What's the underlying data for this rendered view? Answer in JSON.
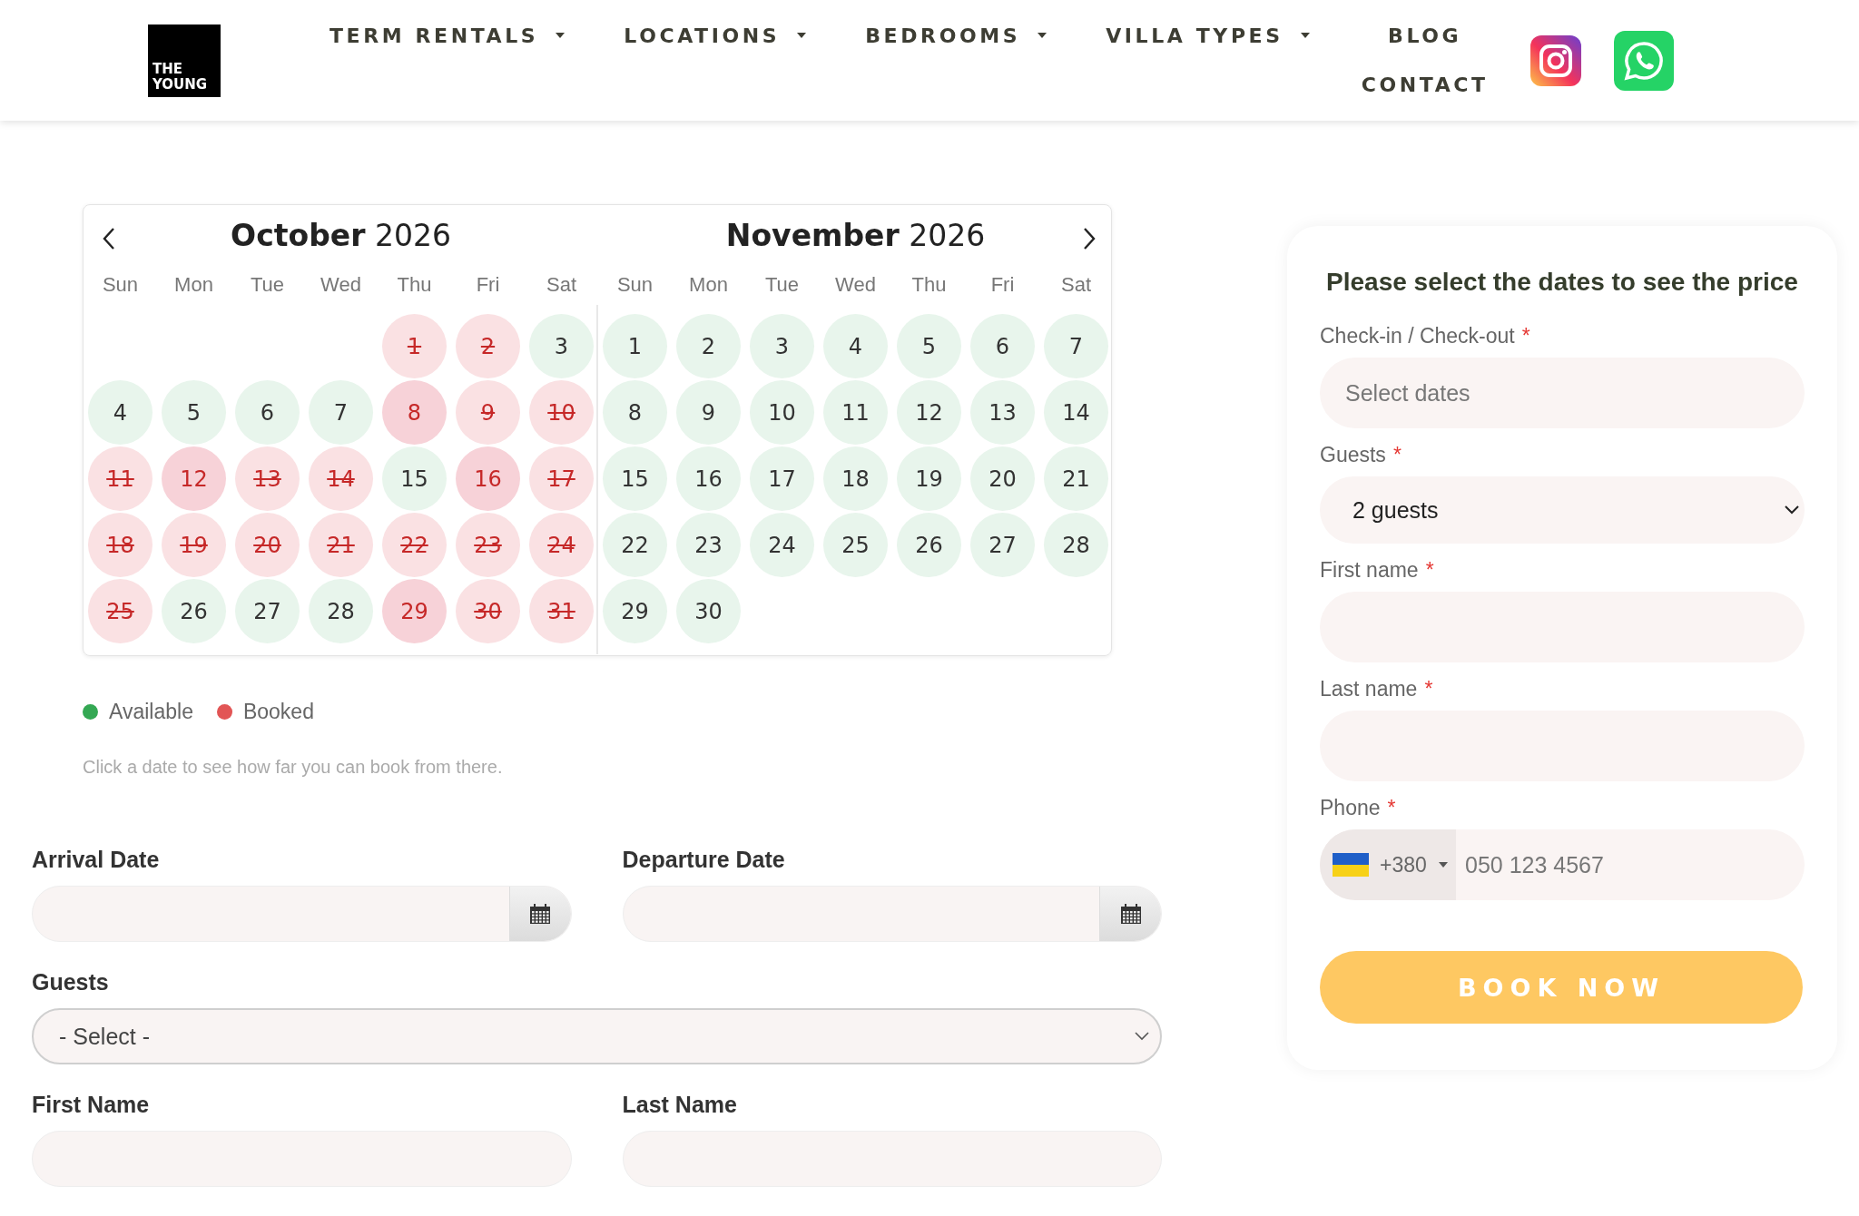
{
  "header": {
    "logo": [
      "THE",
      "YOUNG"
    ],
    "nav": [
      {
        "label": "TERM RENTALS",
        "dropdown": true
      },
      {
        "label": "LOCATIONS",
        "dropdown": true
      },
      {
        "label": "BEDROOMS",
        "dropdown": true
      },
      {
        "label": "VILLA TYPES",
        "dropdown": true
      },
      {
        "label": "BLOG",
        "dropdown": false
      },
      {
        "label": "CONTACT",
        "dropdown": false
      }
    ],
    "social": [
      {
        "kind": "instagram"
      },
      {
        "kind": "whatsapp"
      }
    ]
  },
  "calendar": {
    "months": [
      {
        "name": "October",
        "year": "2026",
        "weekdays": [
          "Sun",
          "Mon",
          "Tue",
          "Wed",
          "Thu",
          "Fri",
          "Sat"
        ],
        "days": [
          {
            "kind": "blank"
          },
          {
            "kind": "blank"
          },
          {
            "kind": "blank"
          },
          {
            "kind": "blank"
          },
          {
            "day": "1",
            "booked": true,
            "highlighted": false
          },
          {
            "day": "2",
            "booked": true,
            "highlighted": false
          },
          {
            "day": "3",
            "booked": false,
            "highlighted": false
          },
          {
            "day": "4",
            "booked": false,
            "highlighted": false
          },
          {
            "day": "5",
            "booked": false,
            "highlighted": false
          },
          {
            "day": "6",
            "booked": false,
            "highlighted": false
          },
          {
            "day": "7",
            "booked": false,
            "highlighted": false
          },
          {
            "day": "8",
            "booked": false,
            "highlighted": true
          },
          {
            "day": "9",
            "booked": true,
            "highlighted": false
          },
          {
            "day": "10",
            "booked": true,
            "highlighted": false
          },
          {
            "day": "11",
            "booked": true,
            "highlighted": false
          },
          {
            "day": "12",
            "booked": false,
            "highlighted": true
          },
          {
            "day": "13",
            "booked": true,
            "highlighted": false
          },
          {
            "day": "14",
            "booked": true,
            "highlighted": false
          },
          {
            "day": "15",
            "booked": false,
            "highlighted": false
          },
          {
            "day": "16",
            "booked": false,
            "highlighted": true
          },
          {
            "day": "17",
            "booked": true,
            "highlighted": false
          },
          {
            "day": "18",
            "booked": true,
            "highlighted": false
          },
          {
            "day": "19",
            "booked": true,
            "highlighted": false
          },
          {
            "day": "20",
            "booked": true,
            "highlighted": false
          },
          {
            "day": "21",
            "booked": true,
            "highlighted": false
          },
          {
            "day": "22",
            "booked": true,
            "highlighted": false
          },
          {
            "day": "23",
            "booked": true,
            "highlighted": false
          },
          {
            "day": "24",
            "booked": true,
            "highlighted": false
          },
          {
            "day": "25",
            "booked": true,
            "highlighted": false
          },
          {
            "day": "26",
            "booked": false,
            "highlighted": false
          },
          {
            "day": "27",
            "booked": false,
            "highlighted": false
          },
          {
            "day": "28",
            "booked": false,
            "highlighted": false
          },
          {
            "day": "29",
            "booked": false,
            "highlighted": true
          },
          {
            "day": "30",
            "booked": true,
            "highlighted": false
          },
          {
            "day": "31",
            "booked": true,
            "highlighted": false
          }
        ]
      },
      {
        "name": "November",
        "year": "2026",
        "weekdays": [
          "Sun",
          "Mon",
          "Tue",
          "Wed",
          "Thu",
          "Fri",
          "Sat"
        ],
        "days": [
          {
            "day": "1",
            "booked": false,
            "highlighted": false
          },
          {
            "day": "2",
            "booked": false,
            "highlighted": false
          },
          {
            "day": "3",
            "booked": false,
            "highlighted": false
          },
          {
            "day": "4",
            "booked": false,
            "highlighted": false
          },
          {
            "day": "5",
            "booked": false,
            "highlighted": false
          },
          {
            "day": "6",
            "booked": false,
            "highlighted": false
          },
          {
            "day": "7",
            "booked": false,
            "highlighted": false
          },
          {
            "day": "8",
            "booked": false,
            "highlighted": false
          },
          {
            "day": "9",
            "booked": false,
            "highlighted": false
          },
          {
            "day": "10",
            "booked": false,
            "highlighted": false
          },
          {
            "day": "11",
            "booked": false,
            "highlighted": false
          },
          {
            "day": "12",
            "booked": false,
            "highlighted": false
          },
          {
            "day": "13",
            "booked": false,
            "highlighted": false
          },
          {
            "day": "14",
            "booked": false,
            "highlighted": false
          },
          {
            "day": "15",
            "booked": false,
            "highlighted": false
          },
          {
            "day": "16",
            "booked": false,
            "highlighted": false
          },
          {
            "day": "17",
            "booked": false,
            "highlighted": false
          },
          {
            "day": "18",
            "booked": false,
            "highlighted": false
          },
          {
            "day": "19",
            "booked": false,
            "highlighted": false
          },
          {
            "day": "20",
            "booked": false,
            "highlighted": false
          },
          {
            "day": "21",
            "booked": false,
            "highlighted": false
          },
          {
            "day": "22",
            "booked": false,
            "highlighted": false
          },
          {
            "day": "23",
            "booked": false,
            "highlighted": false
          },
          {
            "day": "24",
            "booked": false,
            "highlighted": false
          },
          {
            "day": "25",
            "booked": false,
            "highlighted": false
          },
          {
            "day": "26",
            "booked": false,
            "highlighted": false
          },
          {
            "day": "27",
            "booked": false,
            "highlighted": false
          },
          {
            "day": "28",
            "booked": false,
            "highlighted": false
          },
          {
            "day": "29",
            "booked": false,
            "highlighted": false
          },
          {
            "day": "30",
            "booked": false,
            "highlighted": false
          }
        ]
      }
    ],
    "legend": [
      {
        "label": "Available",
        "color": "#34a853"
      },
      {
        "label": "Booked",
        "color": "#e25555"
      }
    ],
    "hint": "Click a date to see how far you can book from there."
  },
  "booking_form": {
    "rows": [
      {
        "kind": "dates",
        "fields": [
          {
            "label": "Arrival Date"
          },
          {
            "label": "Departure Date"
          }
        ]
      },
      {
        "kind": "select",
        "fields": [
          {
            "label": "Guests",
            "value": "- Select -"
          }
        ]
      },
      {
        "kind": "text",
        "fields": [
          {
            "label": "First Name"
          },
          {
            "label": "Last Name"
          }
        ]
      }
    ]
  },
  "price_card": {
    "title": "Please select the dates to see the price",
    "fields": [
      {
        "kind": "text",
        "label": "Check-in / Check-out",
        "required_mark": "*",
        "placeholder": "Select dates"
      },
      {
        "kind": "select",
        "label": "Guests",
        "required_mark": "*",
        "value": "2 guests"
      },
      {
        "kind": "text",
        "label": "First name",
        "required_mark": "*"
      },
      {
        "kind": "text",
        "label": "Last name",
        "required_mark": "*"
      },
      {
        "kind": "phone",
        "label": "Phone",
        "required_mark": "*",
        "code": "+380",
        "placeholder": "050 123 4567"
      }
    ],
    "button": "BOOK NOW"
  }
}
